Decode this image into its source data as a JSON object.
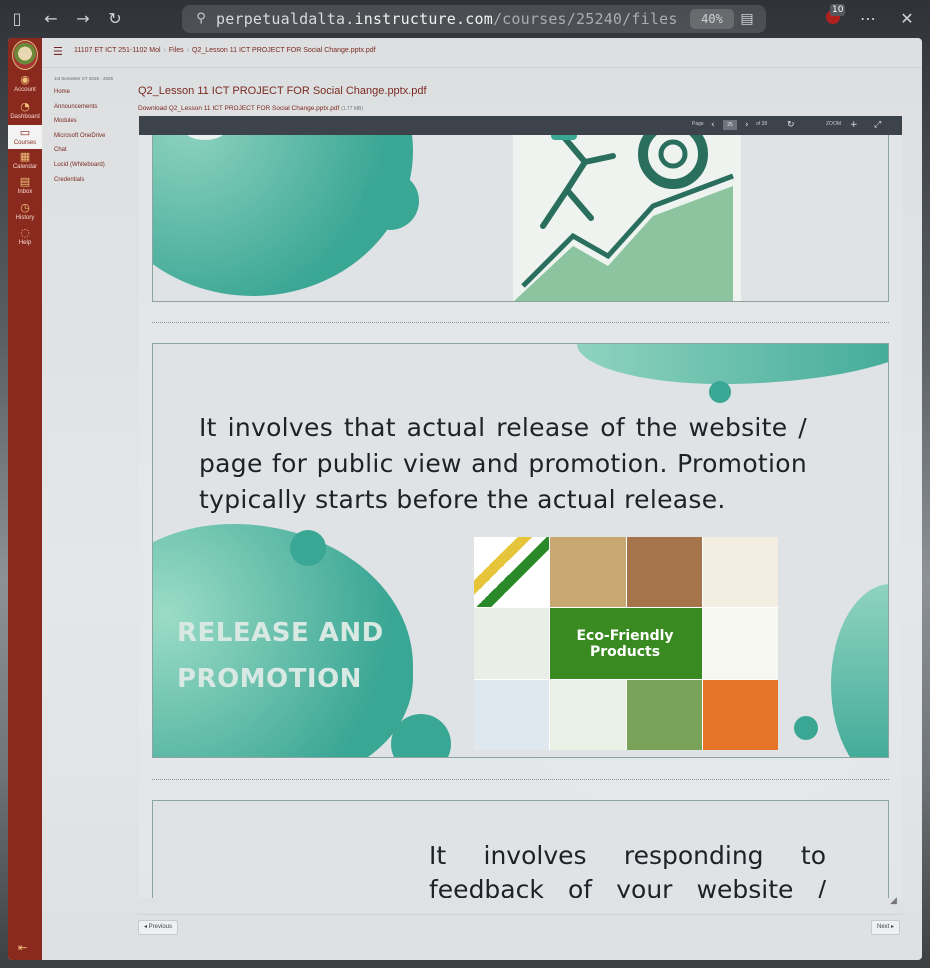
{
  "browser": {
    "url_host_prefix": "perpetualdalta.",
    "url_host": "instructure.com",
    "url_path": "/courses/25240/files",
    "zoom": "40%",
    "extension_count": "10"
  },
  "global_nav": {
    "items": [
      {
        "label": "Account",
        "icon": "user-icon"
      },
      {
        "label": "Dashboard",
        "icon": "dashboard-icon"
      },
      {
        "label": "Courses",
        "icon": "book-icon"
      },
      {
        "label": "Calendar",
        "icon": "calendar-icon"
      },
      {
        "label": "Inbox",
        "icon": "inbox-icon"
      },
      {
        "label": "History",
        "icon": "clock-icon"
      },
      {
        "label": "Help",
        "icon": "help-icon"
      }
    ]
  },
  "breadcrumb": {
    "course": "11107 ET ICT 251-1102 Mol",
    "section": "Files",
    "file": "Q2_Lesson 11 ICT PROJECT FOR Social Change.pptx.pdf"
  },
  "course_nav": {
    "term": "1st Semester SY 2025 - 2026",
    "links": [
      "Home",
      "Announcements",
      "Modules",
      "Microsoft OneDrive",
      "Chat",
      "Lucid (Whiteboard)",
      "Credentials"
    ]
  },
  "file": {
    "title": "Q2_Lesson 11 ICT PROJECT FOR Social Change.pptx.pdf",
    "download_label": "Download Q2_Lesson 11 ICT PROJECT FOR Social Change.pptx.pdf",
    "size": "(1.77 MB)"
  },
  "viewer": {
    "page_label": "Page",
    "page_value": "25",
    "page_of": "of 38",
    "zoom_label": "ZOOM"
  },
  "slides": {
    "release_body": "It involves that actual release of the website / page for public view and promotion. Promotion typically starts before the actual release.",
    "release_title_line1": "RELEASE AND",
    "release_title_line2": "PROMOTION",
    "eco_banner_line1": "Eco-Friendly",
    "eco_banner_line2": "Products",
    "feedback_body": "It involves responding to feedback of your website / page"
  },
  "pager": {
    "previous": "◂ Previous",
    "next": "Next ▸"
  },
  "colors": {
    "nav_bg": "#8a2a1e",
    "link": "#7a2a22",
    "teal": "#3aa694",
    "toolbar": "#3d434a"
  }
}
